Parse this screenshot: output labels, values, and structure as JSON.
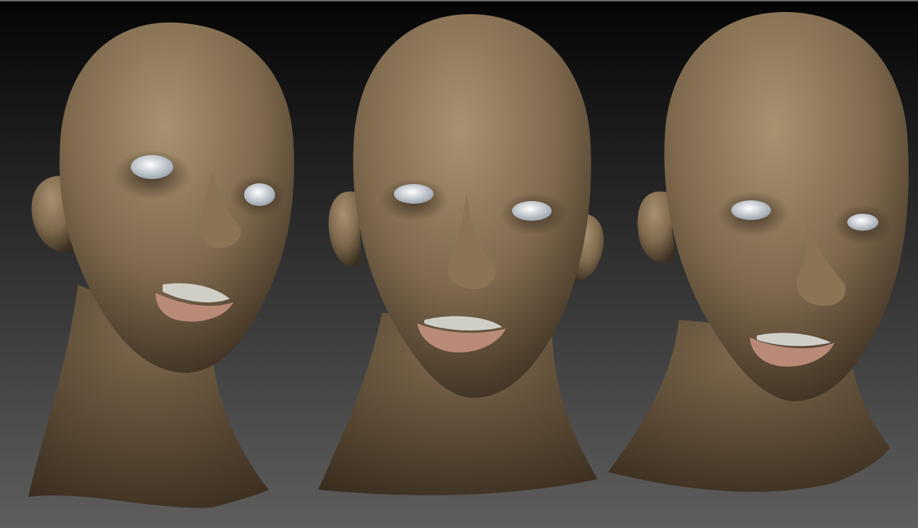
{
  "scene": {
    "background_top": "#050505",
    "background_bottom": "#5e5e5e",
    "skin_base": "#806a4e",
    "skin_highlight": "#a8916f",
    "skin_shadow": "#3a2e20",
    "lip_color": "#b98a76",
    "eye_color": "#e8ecf0",
    "teeth_color": "#cfcfc8",
    "views": [
      {
        "name": "three-quarter-left"
      },
      {
        "name": "front"
      },
      {
        "name": "three-quarter-right"
      }
    ]
  }
}
